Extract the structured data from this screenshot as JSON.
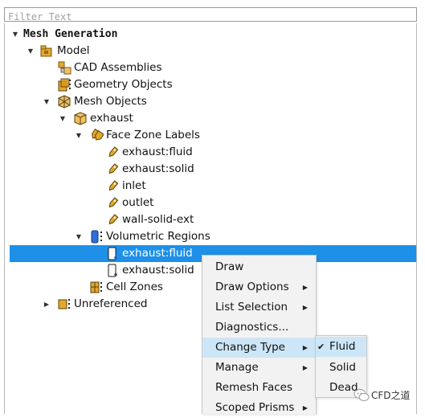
{
  "filter": {
    "placeholder": "Filter Text"
  },
  "tree": {
    "root": "Mesh Generation",
    "model": "Model",
    "cad_assemblies": "CAD Assemblies",
    "geometry_objects": "Geometry Objects",
    "mesh_objects": "Mesh Objects",
    "exhaust": "exhaust",
    "face_zone_labels": "Face Zone Labels",
    "labels": [
      "exhaust:fluid",
      "exhaust:solid",
      "inlet",
      "outlet",
      "wall-solid-ext"
    ],
    "volumetric_regions": "Volumetric Regions",
    "regions": [
      "exhaust:fluid",
      "exhaust:solid"
    ],
    "cell_zones": "Cell Zones",
    "unreferenced": "Unreferenced",
    "selected": "exhaust:fluid"
  },
  "context_menu": {
    "items": [
      "Draw",
      "Draw Options",
      "List Selection",
      "Diagnostics...",
      "Change Type",
      "Manage",
      "Remesh Faces",
      "Scoped Prisms"
    ],
    "has_submenu": [
      false,
      true,
      true,
      false,
      true,
      true,
      false,
      true
    ],
    "highlighted": "Change Type"
  },
  "submenu": {
    "items": [
      "Fluid",
      "Solid",
      "Dead"
    ],
    "checked": "Fluid",
    "check_glyph": "✔"
  },
  "watermark": {
    "text": "CFD之道"
  },
  "colors": {
    "selection": "#1e90e8",
    "menu_highlight": "#cde6f7",
    "menu_bg": "#f2f2f2",
    "folder_icon": "#e3a82b",
    "region_icon": "#2f6fd6"
  }
}
